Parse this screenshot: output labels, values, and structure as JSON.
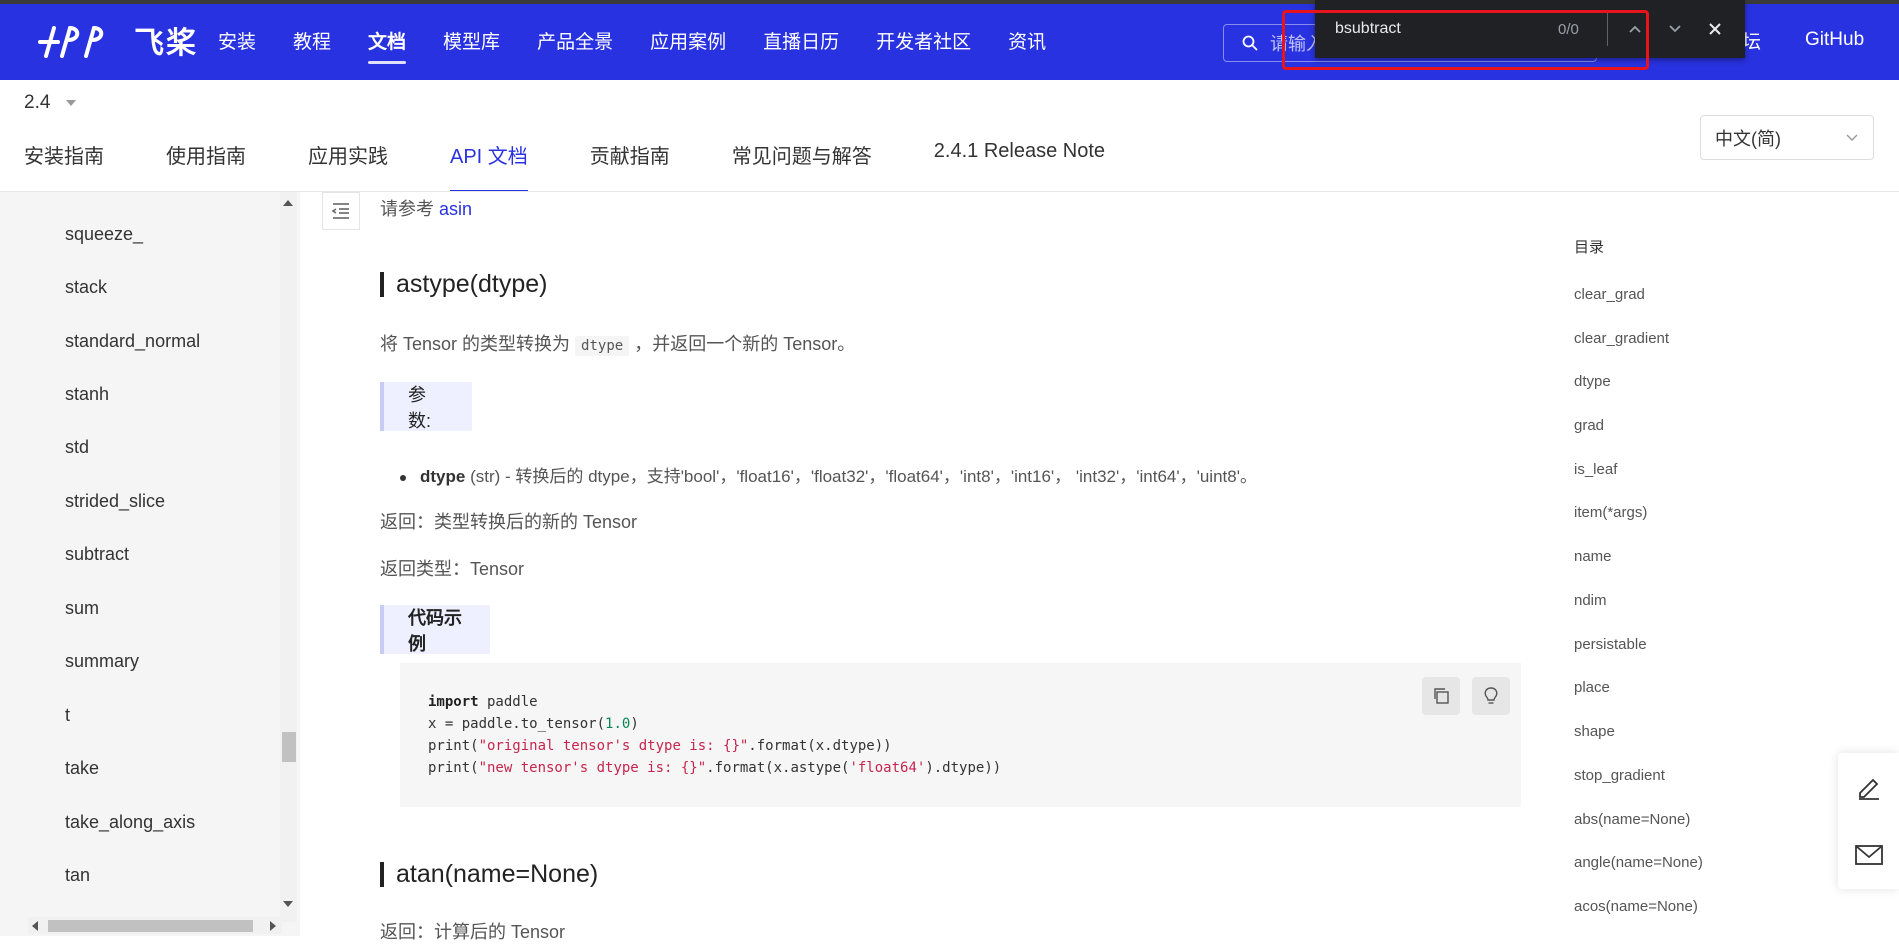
{
  "brand": {
    "logo_text": "飞桨",
    "accent": "#2932e1"
  },
  "nav": {
    "items": [
      "安装",
      "教程",
      "文档",
      "模型库",
      "产品全景",
      "应用案例",
      "直播日历",
      "开发者社区",
      "资讯"
    ],
    "active": "文档",
    "search_placeholder": "请输入",
    "forum_partial": "坛",
    "github": "GitHub"
  },
  "findbar": {
    "query": "bsubtract",
    "count": "0/0"
  },
  "version": {
    "value": "2.4"
  },
  "tabs": {
    "items": [
      "安装指南",
      "使用指南",
      "应用实践",
      "API 文档",
      "贡献指南",
      "常见问题与解答",
      "2.4.1 Release Note"
    ],
    "active": "API 文档"
  },
  "language": {
    "selected": "中文(简)"
  },
  "sidebar": {
    "items": [
      "squeeze_",
      "stack",
      "standard_normal",
      "stanh",
      "std",
      "strided_slice",
      "subtract",
      "sum",
      "summary",
      "t",
      "take",
      "take_along_axis",
      "tan"
    ]
  },
  "content": {
    "ref_prefix": "请参考",
    "ref_link": "asin",
    "astype": {
      "heading": "astype(dtype)",
      "desc_before": "将 Tensor 的类型转换为",
      "desc_code": "dtype",
      "desc_after": "，并返回一个新的 Tensor。",
      "params_label": "参数:",
      "param_name": "dtype",
      "param_desc": " (str) - 转换后的 dtype，支持'bool'，'float16'，'float32'，'float64'，'int8'，'int16'， 'int32'，'int64'，'uint8'。",
      "returns": "返回：类型转换后的新的 Tensor",
      "return_type": "返回类型：Tensor",
      "example_label": "代码示例"
    },
    "code": {
      "l1_kw": "import",
      "l1_rest": " paddle",
      "l2_pre": "x = paddle.to_tensor(",
      "l2_num": "1.0",
      "l2_post": ")",
      "l3_pre": "print(",
      "l3_str": "\"original tensor's dtype is: {}\"",
      "l3_post": ".format(x.dtype))",
      "l4_pre": "print(",
      "l4_str": "\"new tensor's dtype is: {}\"",
      "l4_mid": ".format(x.astype(",
      "l4_str2": "'float64'",
      "l4_post": ").dtype))"
    },
    "atan": {
      "heading": "atan(name=None)",
      "returns": "返回：计算后的 Tensor"
    }
  },
  "toc": {
    "title": "目录",
    "items": [
      "clear_grad",
      "clear_gradient",
      "dtype",
      "grad",
      "is_leaf",
      "item(*args)",
      "name",
      "ndim",
      "persistable",
      "place",
      "shape",
      "stop_gradient",
      "abs(name=None)",
      "angle(name=None)",
      "acos(name=None)"
    ]
  }
}
